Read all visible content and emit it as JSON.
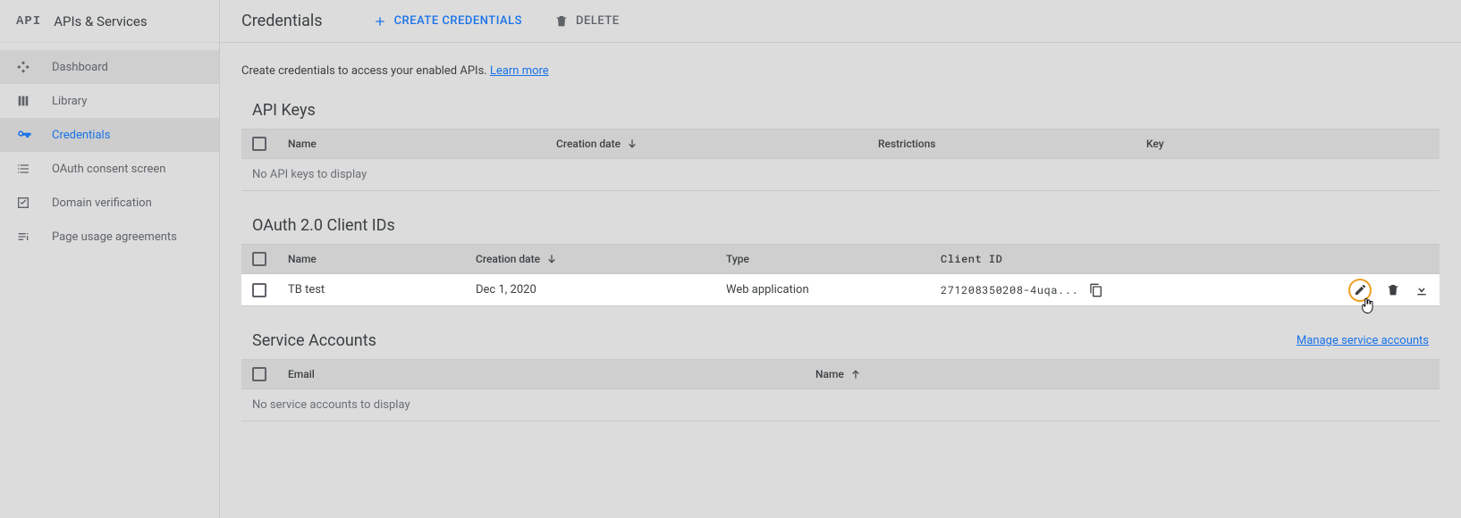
{
  "sidebar": {
    "logo": "API",
    "title": "APIs & Services",
    "items": [
      {
        "label": "Dashboard"
      },
      {
        "label": "Library"
      },
      {
        "label": "Credentials"
      },
      {
        "label": "OAuth consent screen"
      },
      {
        "label": "Domain verification"
      },
      {
        "label": "Page usage agreements"
      }
    ]
  },
  "header": {
    "title": "Credentials",
    "create_label": "CREATE CREDENTIALS",
    "delete_label": "DELETE"
  },
  "intro": {
    "text": "Create credentials to access your enabled APIs. ",
    "link": "Learn more"
  },
  "api_keys": {
    "title": "API Keys",
    "columns": {
      "name": "Name",
      "date": "Creation date",
      "restrictions": "Restrictions",
      "key": "Key"
    },
    "empty": "No API keys to display"
  },
  "oauth": {
    "title": "OAuth 2.0 Client IDs",
    "columns": {
      "name": "Name",
      "date": "Creation date",
      "type": "Type",
      "client_id": "Client ID"
    },
    "rows": [
      {
        "name": "TB test",
        "date": "Dec 1, 2020",
        "type": "Web application",
        "client_id": "271208350208-4uqa..."
      }
    ]
  },
  "service_accounts": {
    "title": "Service Accounts",
    "link": "Manage service accounts",
    "columns": {
      "email": "Email",
      "name": "Name"
    },
    "empty": "No service accounts to display"
  }
}
